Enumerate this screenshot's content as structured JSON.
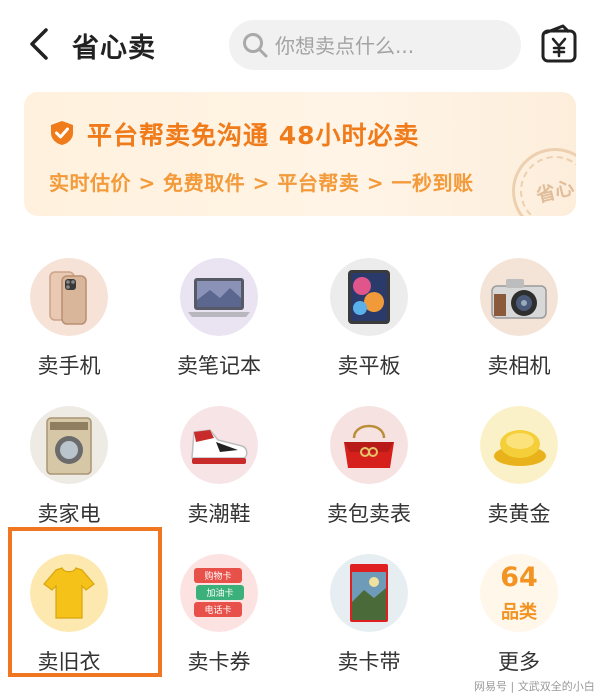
{
  "header": {
    "title": "省心卖",
    "search_placeholder": "你想卖点什么..."
  },
  "banner": {
    "headline": "平台帮卖免沟通 48小时必卖",
    "steps": "实时估价 > 免费取件 > 平台帮卖 > 一秒到账",
    "stamp": "省心"
  },
  "categories": [
    {
      "label": "卖手机",
      "icon": "phone-icon"
    },
    {
      "label": "卖笔记本",
      "icon": "laptop-icon"
    },
    {
      "label": "卖平板",
      "icon": "tablet-icon"
    },
    {
      "label": "卖相机",
      "icon": "camera-icon"
    },
    {
      "label": "卖家电",
      "icon": "washing-machine-icon"
    },
    {
      "label": "卖潮鞋",
      "icon": "sneaker-icon"
    },
    {
      "label": "卖包卖表",
      "icon": "handbag-icon"
    },
    {
      "label": "卖黄金",
      "icon": "gold-icon"
    },
    {
      "label": "卖旧衣",
      "icon": "tshirt-icon"
    },
    {
      "label": "卖卡券",
      "icon": "gift-card-icon"
    },
    {
      "label": "卖卡带",
      "icon": "game-cartridge-icon"
    },
    {
      "label": "更多",
      "icon": "more-icon",
      "count": "64",
      "unit": "品类"
    }
  ],
  "gift_cards": [
    "购物卡",
    "加油卡",
    "电话卡"
  ],
  "watermark": "网易号 | 文武双全的小白",
  "colors": {
    "accent_orange": "#f07b1a",
    "highlight_border": "#f07622",
    "banner_bg": "#fff1dd"
  }
}
